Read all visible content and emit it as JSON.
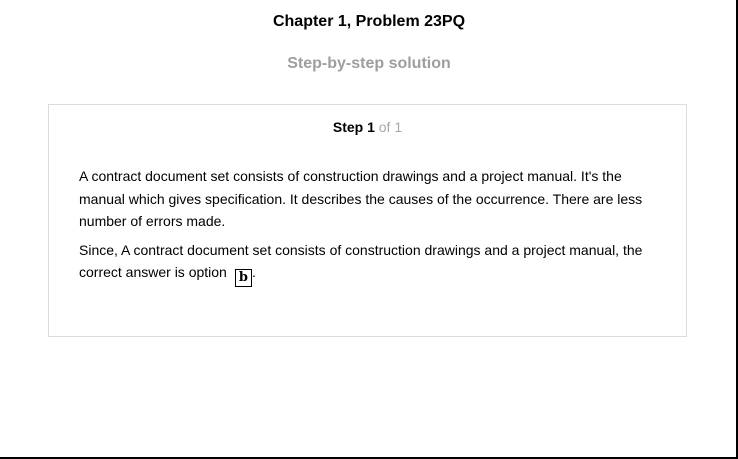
{
  "header": {
    "title": "Chapter 1, Problem 23PQ",
    "subtitle": "Step-by-step solution"
  },
  "step": {
    "label": "Step 1",
    "of": "of 1"
  },
  "solution": {
    "paragraph1": "A contract document set consists of construction drawings and a project manual. It's the manual which gives specification. It describes the causes of the occurrence. There are less number of errors made.",
    "paragraph2_prefix": "Since, A contract document set consists of construction drawings and a project manual, the correct answer is option",
    "answer": "b",
    "paragraph2_suffix": "."
  }
}
